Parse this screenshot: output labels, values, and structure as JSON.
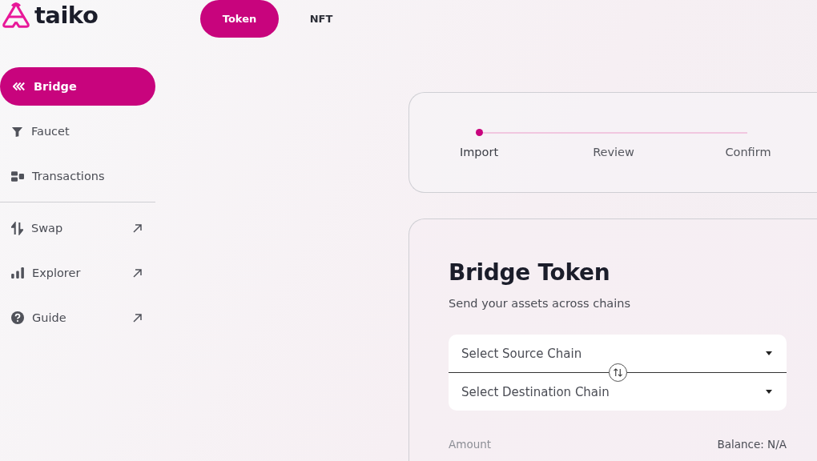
{
  "logo": {
    "text": "taiko"
  },
  "tabs": [
    {
      "label": "Token",
      "selected": true
    },
    {
      "label": "NFT",
      "selected": false
    }
  ],
  "sidebar": {
    "items": [
      {
        "label": "Bridge",
        "selected": true
      },
      {
        "label": "Faucet",
        "selected": false
      },
      {
        "label": "Transactions",
        "selected": false
      }
    ],
    "external_items": [
      {
        "label": "Swap",
        "kind": "external"
      },
      {
        "label": "Explorer",
        "kind": "external"
      },
      {
        "label": "Guide",
        "kind": "external"
      }
    ]
  },
  "steps": [
    {
      "label": "Import",
      "active": true
    },
    {
      "label": "Review",
      "active": false
    },
    {
      "label": "Confirm",
      "active": false
    }
  ],
  "bridge": {
    "title": "Bridge Token",
    "subtitle": "Send your assets across chains",
    "source": {
      "placeholder": "Select Source Chain"
    },
    "destination": {
      "placeholder": "Select Destination Chain"
    },
    "amount_label": "Amount",
    "balance": "Balance: N/A"
  }
}
